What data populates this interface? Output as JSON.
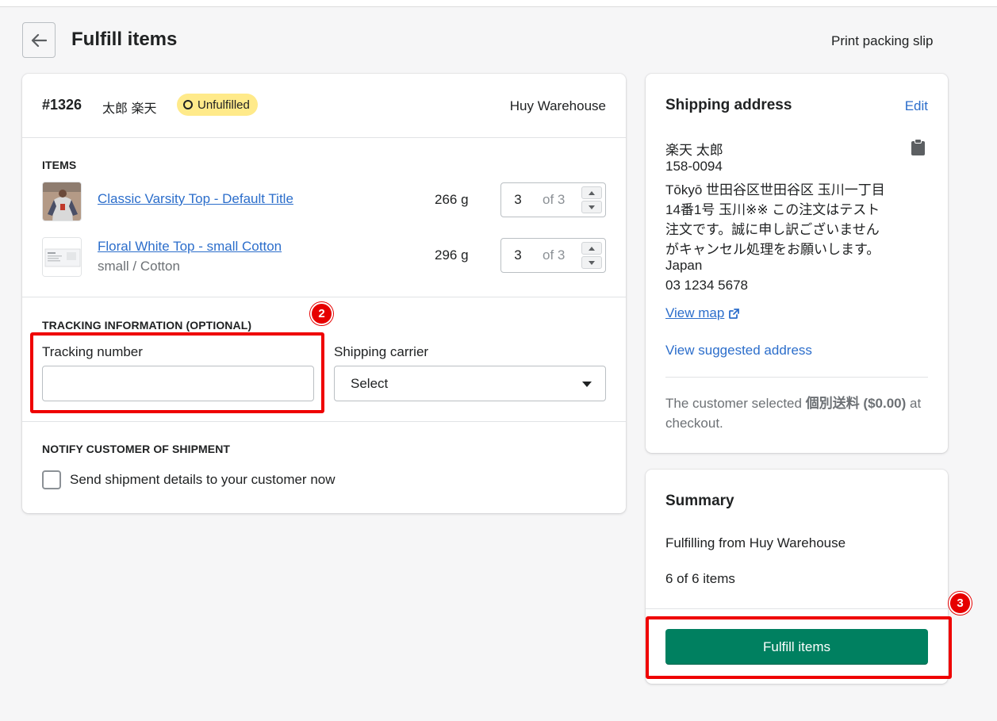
{
  "header": {
    "title": "Fulfill items",
    "print_label": "Print packing slip"
  },
  "order": {
    "number": "#1326",
    "customer": "太郎 楽天",
    "status": "Unfulfilled",
    "location": "Huy Warehouse"
  },
  "items_section": {
    "label": "ITEMS",
    "items": [
      {
        "title": "Classic Varsity Top - Default Title",
        "variant": "",
        "weight": "266 g",
        "qty": "3",
        "of": "of 3"
      },
      {
        "title": "Floral White Top - small Cotton",
        "variant": "small / Cotton",
        "weight": "296 g",
        "qty": "3",
        "of": "of 3"
      }
    ]
  },
  "tracking": {
    "label": "TRACKING INFORMATION (OPTIONAL)",
    "number_label": "Tracking number",
    "number_value": "",
    "carrier_label": "Shipping carrier",
    "carrier_value": "Select"
  },
  "notify": {
    "label": "NOTIFY CUSTOMER OF SHIPMENT",
    "checkbox_label": "Send shipment details to your customer now",
    "checked": false
  },
  "shipping": {
    "title": "Shipping address",
    "edit_label": "Edit",
    "lines": [
      "楽天 太郎",
      "158-0094",
      "Tōkyō 世田谷区世田谷区 玉川一丁目",
      "14番1号 玉川※※ この注文はテスト",
      "注文です。誠に申し訳ございません",
      "がキャンセル処理をお願いします。",
      "Japan",
      "03 1234 5678"
    ],
    "view_map": "View map",
    "view_suggested": "View suggested address",
    "note_prefix": "The customer selected ",
    "note_rate": "個別送料 ($0.00)",
    "note_suffix": " at checkout."
  },
  "summary": {
    "title": "Summary",
    "from": "Fulfilling from Huy Warehouse",
    "count": "6 of 6 items",
    "button": "Fulfill items"
  },
  "annotations": {
    "tracking_marker": "2",
    "fulfill_marker": "3"
  },
  "colors": {
    "primary": "#008060",
    "link": "#2c6ecb",
    "badge": "#ffea8a",
    "annotation": "#e60000"
  }
}
